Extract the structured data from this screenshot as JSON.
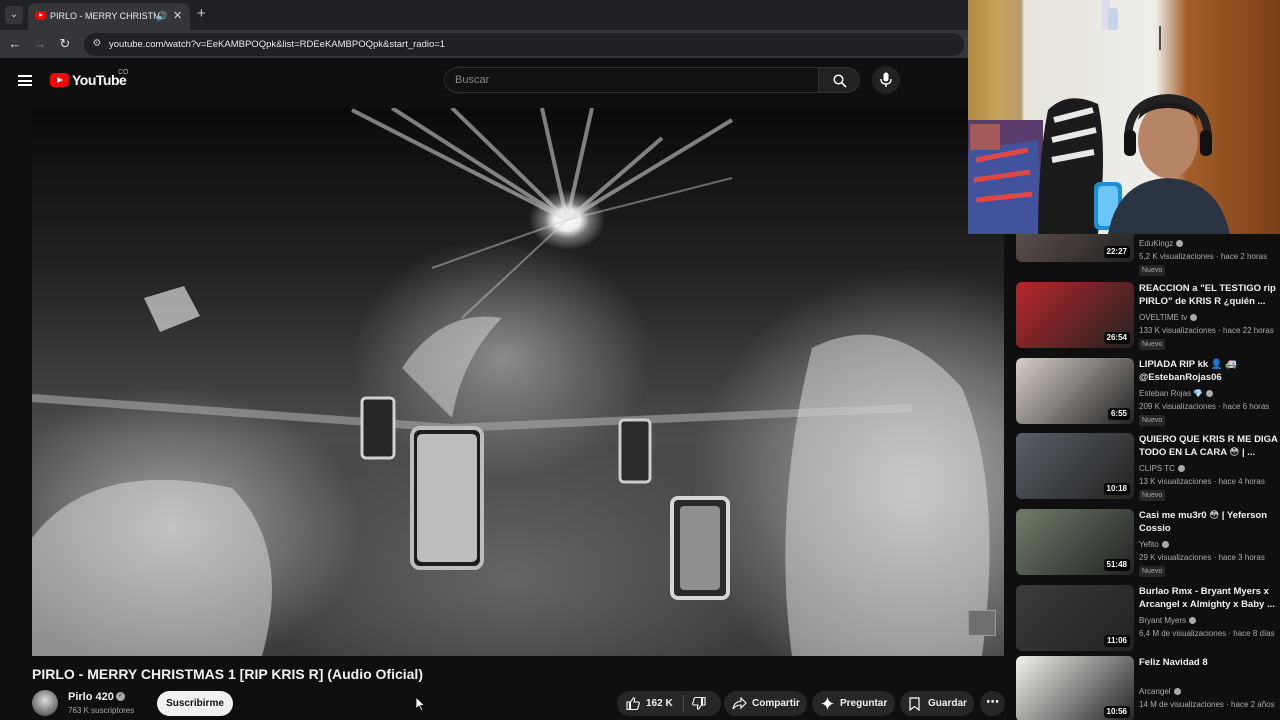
{
  "browser": {
    "tab_title": "PIRLO - MERRY CHRISTMAS",
    "audio_icon": "speaker-icon",
    "url": "youtube.com/watch?v=EeKAMBPOQpk&list=RDEeKAMBPOQpk&start_radio=1"
  },
  "header": {
    "logo_text": "YouTube",
    "country_code": "CO",
    "search_placeholder": "Buscar"
  },
  "video": {
    "title": "PIRLO - MERRY CHRISTMAS 1 [RIP KRIS R] (Audio Oficial)",
    "channel": "Pirlo 420",
    "subscribers": "763 K suscriptores",
    "subscribe_label": "Suscribirme",
    "like_count": "162 K",
    "share_label": "Compartir",
    "ask_label": "Preguntar",
    "save_label": "Guardar"
  },
  "recommendations": [
    {
      "title": "",
      "channel": "EduKingz",
      "meta": "5,2 K visualizaciones · hace 2 horas",
      "badge": "Nuevo",
      "duration": "22:27",
      "thumb_color": "#6a5a55"
    },
    {
      "title": "REACCION a \"EL TESTIGO rip PIRLO\" de KRIS R ¿quién ...",
      "channel": "OVELTIME tv",
      "meta": "133 K visualizaciones · hace 22 horas",
      "badge": "Nuevo",
      "duration": "26:54",
      "thumb_color": "#b8262a"
    },
    {
      "title": "LIPIADA RIP kk 👤 🚑 @EstebanRojas06",
      "channel": "Esteban Rojas 💎",
      "meta": "209 K visualizaciones · hace 6 horas",
      "badge": "Nuevo",
      "duration": "6:55",
      "thumb_color": "#d8d0c8"
    },
    {
      "title": "QUIERO QUE KRIS R ME DIGA TODO EN LA CARA 😳 | ...",
      "channel": "CLIPS TC",
      "meta": "13 K visualizaciones · hace 4 horas",
      "badge": "Nuevo",
      "duration": "10:18",
      "thumb_color": "#5a5f66"
    },
    {
      "title": "Casi me mu3r0 😳 | Yeferson Cossio",
      "channel": "Yefito",
      "meta": "29 K visualizaciones · hace 3 horas",
      "badge": "Nuevo",
      "duration": "51:48",
      "thumb_color": "#6f7d6a"
    },
    {
      "title": "Burlao Rmx - Bryant Myers x Arcangel x Almighty x Baby ...",
      "channel": "Bryant Myers",
      "meta": "6,4 M de visualizaciones · hace 8 días",
      "badge": "",
      "duration": "11:06",
      "thumb_color": "#3c3c3c"
    },
    {
      "title": "Feliz Navidad 8",
      "channel": "Arcangel",
      "meta": "14 M de visualizaciones · hace 2 años",
      "badge": "",
      "duration": "10:56",
      "thumb_color": "#f2f2ee"
    }
  ],
  "colors": {
    "background": "#0f0f0f",
    "brand_red": "#ff0000",
    "pill": "#272727"
  }
}
